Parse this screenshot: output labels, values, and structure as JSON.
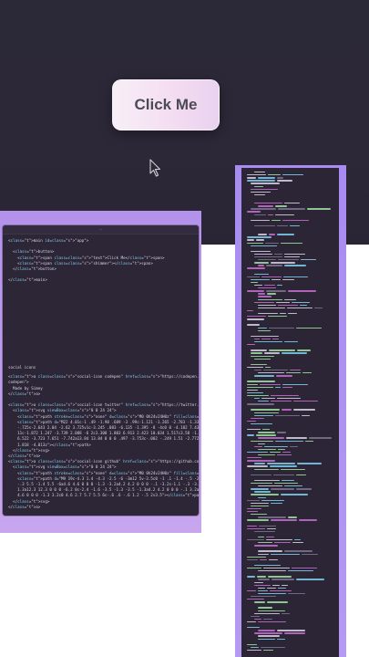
{
  "hero": {
    "button_label": "Click Me"
  },
  "left_editor": {
    "lines_top": [
      "<main id=\"app\">",
      "",
      "  <button>",
      "    <span class=\"text\">Click Me</span>",
      "    <span class=\"shimmer\"></span>",
      "  </button>",
      "",
      "</main>"
    ],
    "section_comment": "social icons",
    "lines_bottom": [
      "<a class=\"social-icon codepen\" href=\"https://codepen.io/simeydotme\" title=\"View my",
      "codepen\">",
      "  Made by Simey",
      "</a>",
      "",
      "<a class=\"social-icon twitter\" href=\"https://twitter.com/simeydotme\">",
      "  <svg viewBox=\"0 0 24 24\">",
      "    <path stroke=\"none\" d=\"M0 0h24v24H0z\" fill=\"none\"></path>",
      "    <path d=\"M22 4.01c-1 .49 -1.98 .689 -3 .99c-1.121 -1.265 -2.783 -1.335 -4.38",
      "    -.725s-2.643 2.04 -2.62 3.725v1c-3.245 .083 -6.135 -1.395 -8 -4c0 0 -4.182 7.433 4",
      "    11c-1.872 1.247 -3.739 2.088 -6 2c3.308 1.803 6.913 2.423 10.034 1.517c3.58 -1.04",
      "    6.522 -3.723 7.651 -7.742a13.84 13.84 0 0 0 .497 -3.753c-.002 -.249 1.51 -2.772",
      "    1.818 -4.013z\"></path>",
      "  </svg>",
      "</a>",
      "<a class=\"social-icon github\" href=\"https://github.com/simeydotme\">",
      "  <svg viewBox=\"0 0 24 24\">",
      "    <path stroke=\"none\" d=\"M0 0h24v24H0z\" fill=\"none\"></path>",
      "    <path d=\"M9 19c-4.3 1.4 -4.3 -2.5 -6 -3m12 5v-3.5c0 -1 .1 -1.4 -.5 -2c2.8",
      "    -.3 5.5 -1.4 5.5 -6a4.6 4.6 0 0 0 -1.3 -3.2a4.2 4.2 0 0 0 -.1 -3.2s-1.1 -.3 -3.5",
      "    1.3a12.3 12.3 0 0 0 -6.2 0c-2.4 -1.6 -3.5 -1.3 -3.5 -1.3a4.2 4.2 0 0 0 -.1 3.2a4.6",
      "    4.6 0 0 0 -1.3 3.2c0 4.6 2.7 5.7 5.5 6c-.6 .6 -.6 1.2 -.5 2v3.5\"></path>",
      "  </svg>",
      "</a>"
    ]
  },
  "colors": {
    "hero_bg": "#2b2838",
    "frame_purple": "#b392ec",
    "editor_bg": "#2c2636",
    "tag": "#c96fd4",
    "attr": "#7fd0f0",
    "string": "#a0e3a1"
  },
  "icons": {
    "cursor": "mouse-pointer-icon"
  }
}
